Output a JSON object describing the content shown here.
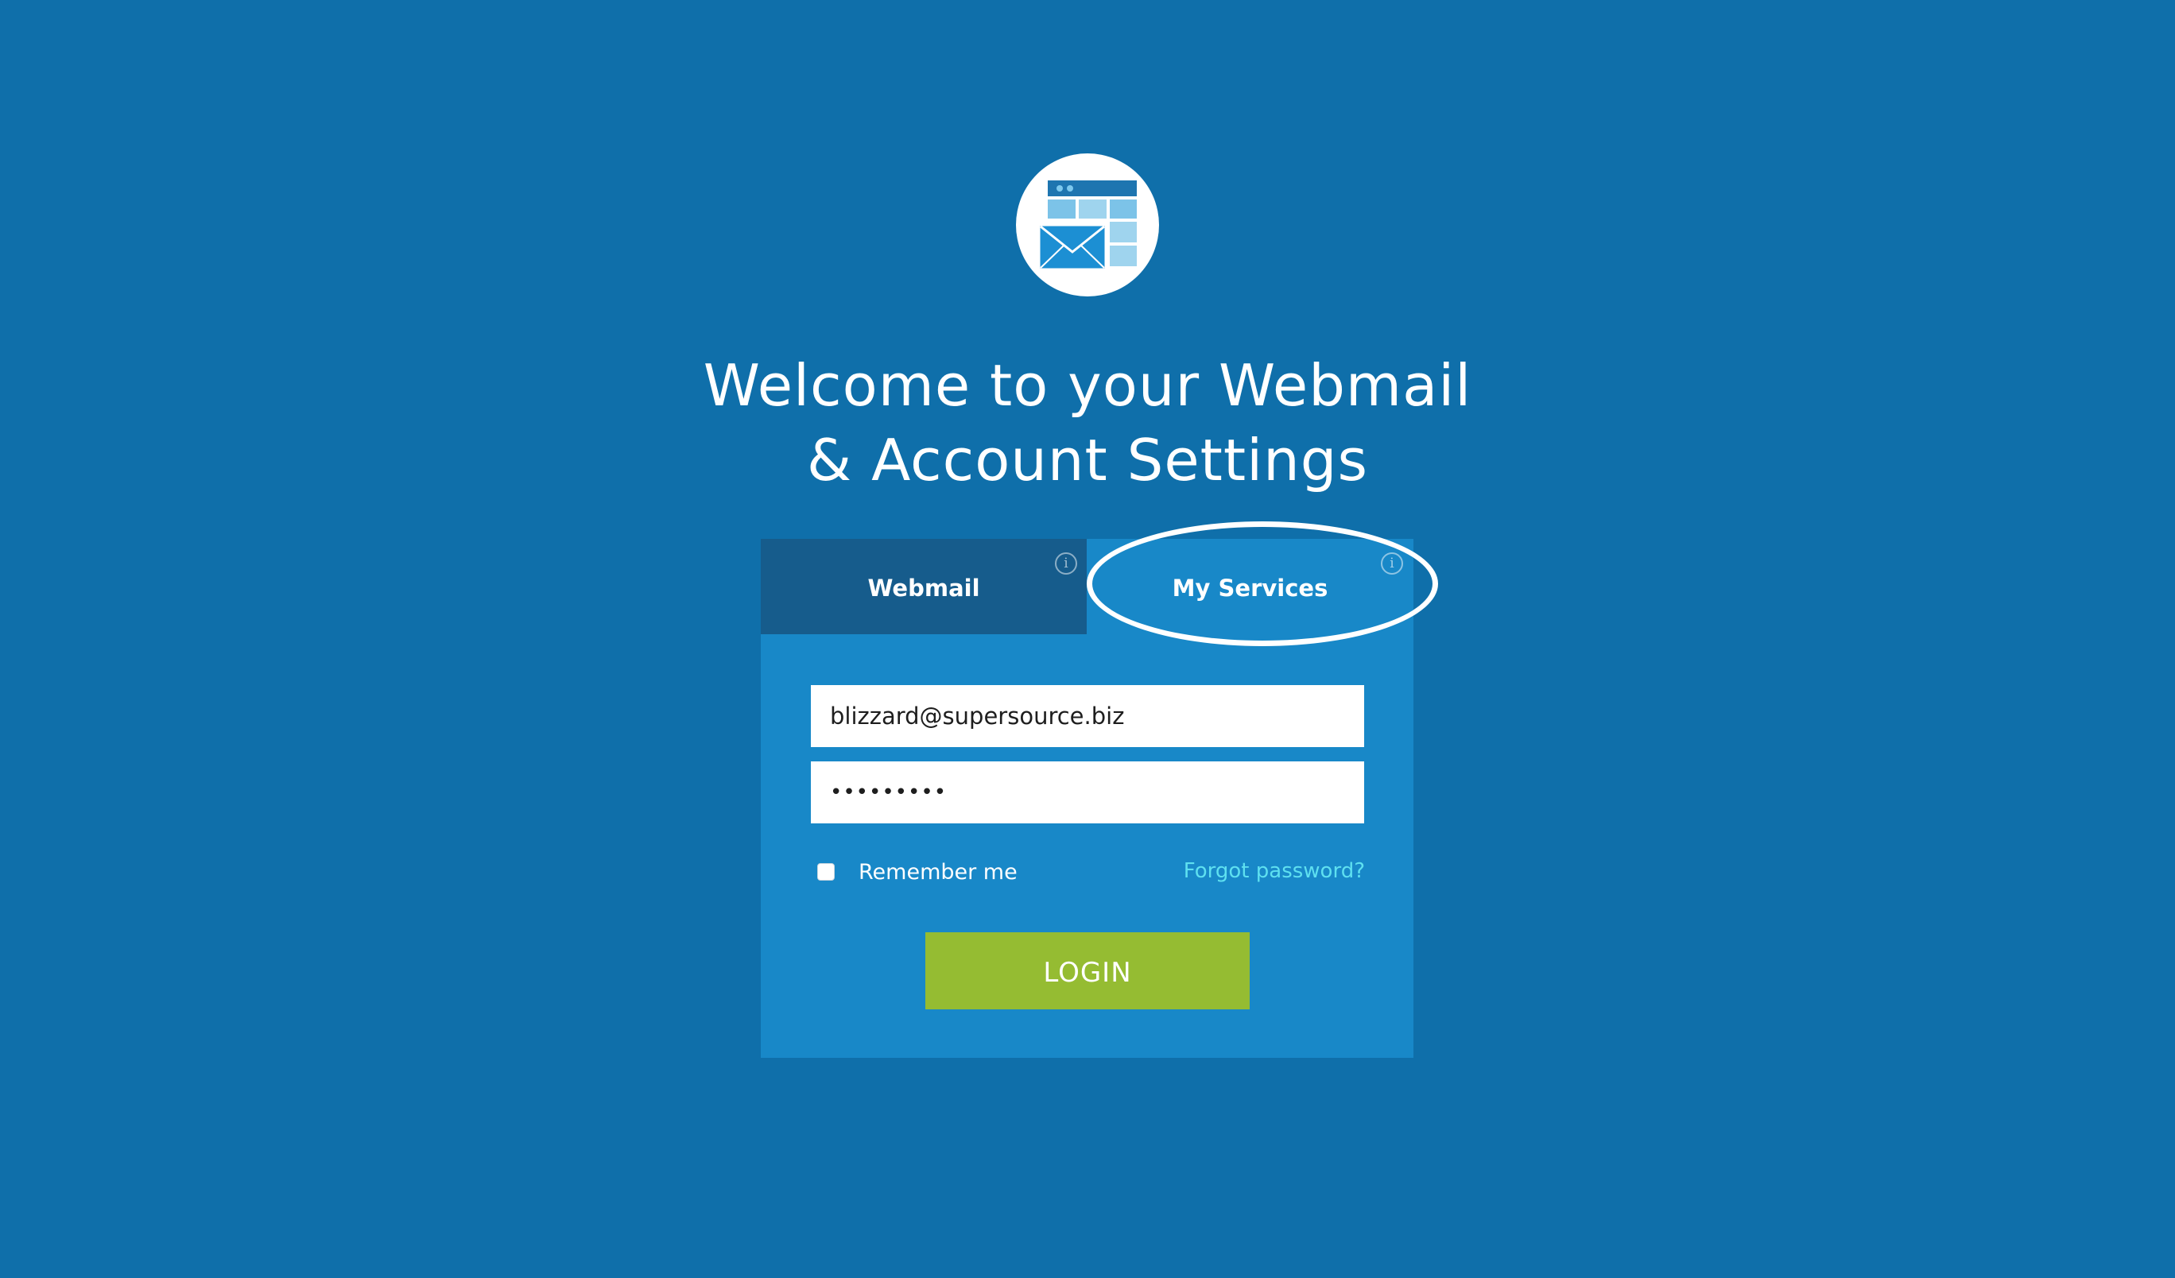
{
  "logo": {
    "icon": "webmail-window-envelope-icon"
  },
  "heading": {
    "line1": "Welcome to your Webmail",
    "line2": "& Account Settings"
  },
  "tabs": [
    {
      "label": "Webmail",
      "info_icon": "info-icon"
    },
    {
      "label": "My Services",
      "info_icon": "info-icon"
    }
  ],
  "form": {
    "email_value": "blizzard@supersource.biz",
    "password_value": "•••••••••",
    "remember_label": "Remember me",
    "forgot_label": "Forgot password?",
    "login_label": "LOGIN"
  },
  "colors": {
    "background": "#0f6faa",
    "panel": "#1888c8",
    "inactive_tab": "#165c8c",
    "login_button": "#95bc32",
    "link": "#5ee0f0"
  }
}
